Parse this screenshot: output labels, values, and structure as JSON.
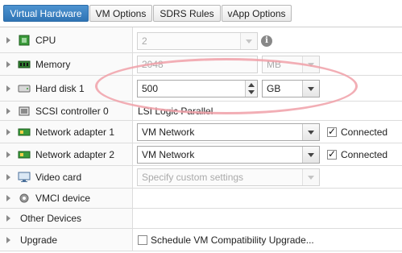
{
  "tabs": [
    {
      "label": "Virtual Hardware",
      "active": true
    },
    {
      "label": "VM Options",
      "active": false
    },
    {
      "label": "SDRS Rules",
      "active": false
    },
    {
      "label": "vApp Options",
      "active": false
    }
  ],
  "rows": {
    "cpu": {
      "label": "CPU",
      "value": "2",
      "icon": "cpu-chip-icon"
    },
    "memory": {
      "label": "Memory",
      "value": "2048",
      "unit": "MB",
      "icon": "memory-module-icon"
    },
    "hard_disk": {
      "label": "Hard disk 1",
      "value": "500",
      "unit": "GB",
      "icon": "hard-disk-icon"
    },
    "scsi": {
      "label": "SCSI controller 0",
      "value": "LSI Logic Parallel",
      "icon": "scsi-controller-icon"
    },
    "network1": {
      "label": "Network adapter 1",
      "value": "VM Network",
      "connected_label": "Connected",
      "connected": true,
      "icon": "network-card-icon"
    },
    "network2": {
      "label": "Network adapter 2",
      "value": "VM Network",
      "connected_label": "Connected",
      "connected": true,
      "icon": "network-card-icon"
    },
    "video": {
      "label": "Video card",
      "placeholder": "Specify custom settings",
      "icon": "monitor-icon"
    },
    "vmci": {
      "label": "VMCI device",
      "icon": "gear-icon"
    },
    "other": {
      "label": "Other Devices"
    },
    "upgrade": {
      "label": "Upgrade",
      "checkbox_label": "Schedule VM Compatibility Upgrade...",
      "checked": false
    }
  },
  "colors": {
    "tab_active": "#3a80c0",
    "highlight_ellipse": "#f0a0a8",
    "chip_green": "#3a9a3a"
  }
}
